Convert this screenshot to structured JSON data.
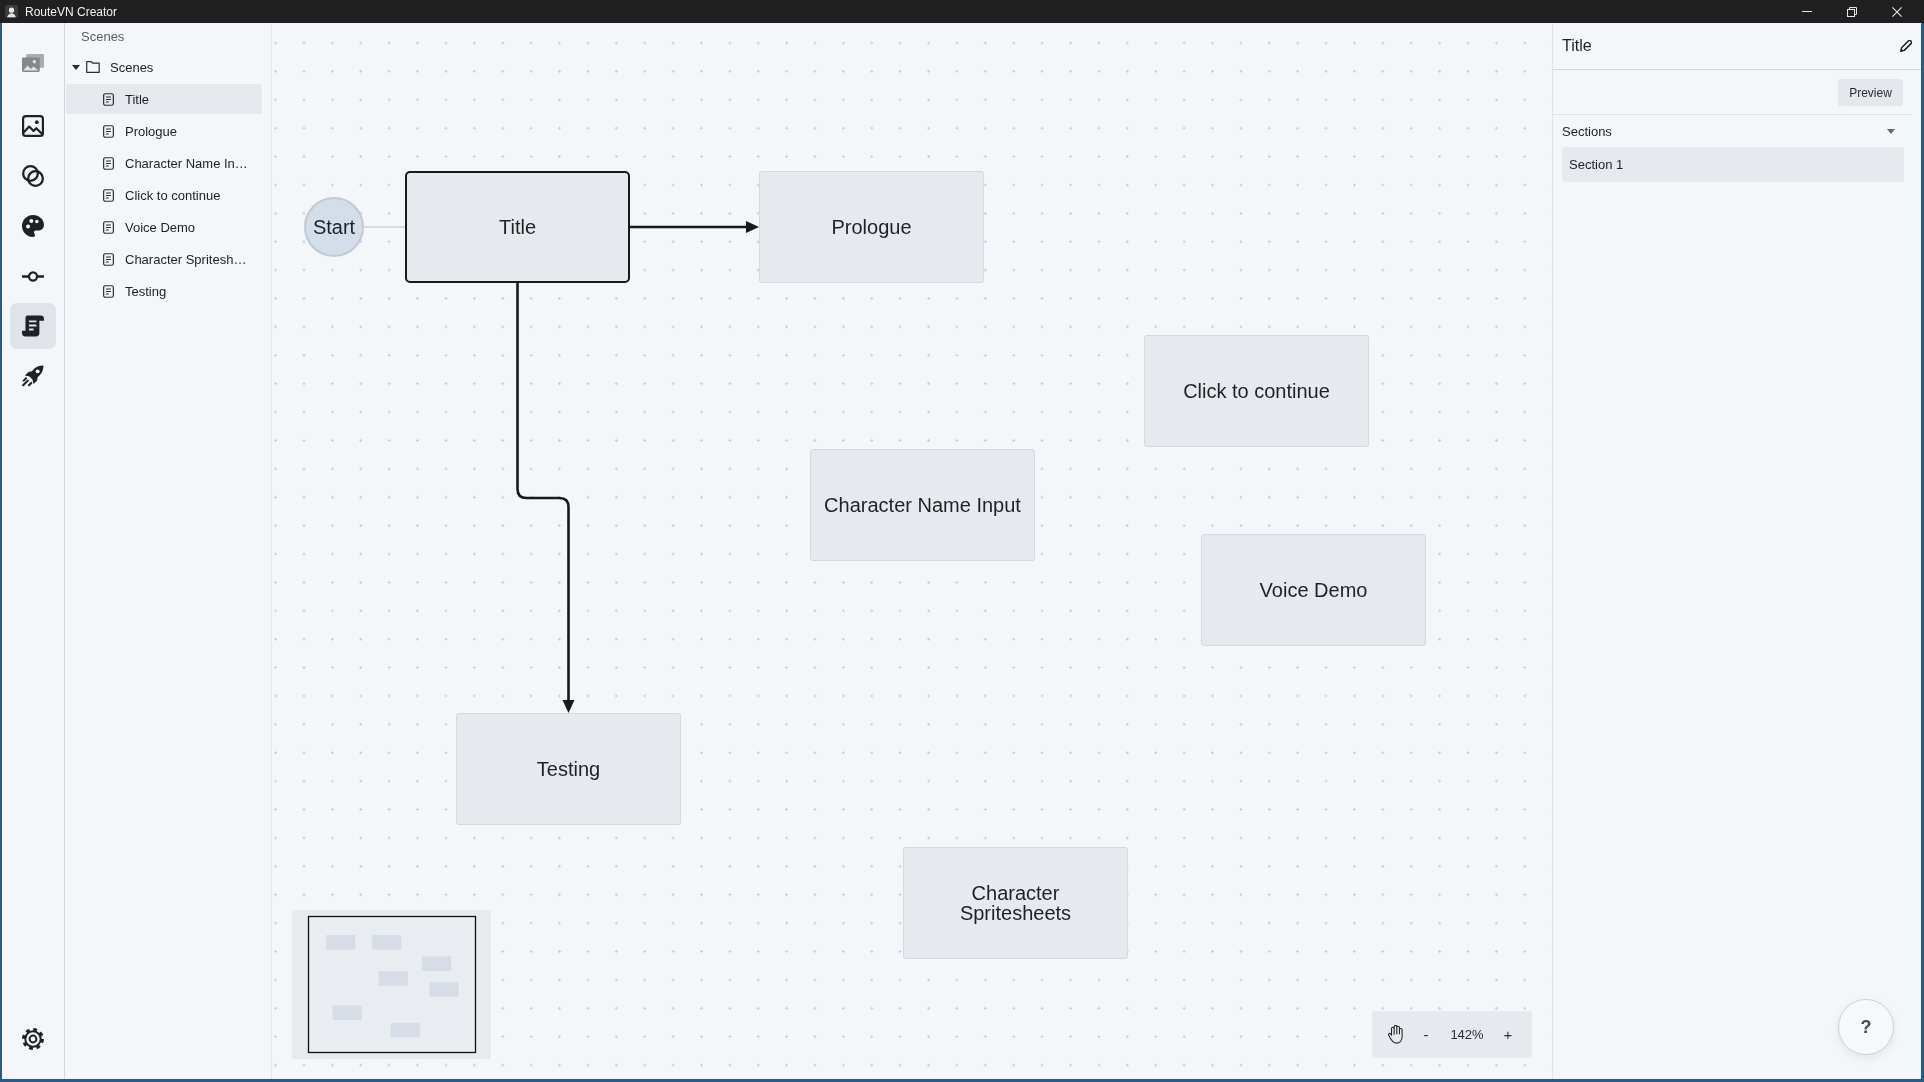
{
  "window": {
    "title": "RouteVN Creator"
  },
  "nav_rail": [
    {
      "selected": false
    },
    {
      "selected": false
    },
    {
      "selected": false
    },
    {
      "selected": false
    },
    {
      "selected": false
    },
    {
      "selected": true
    },
    {
      "selected": false
    }
  ],
  "sidebar": {
    "title": "Scenes",
    "tree": [
      {
        "label": "Scenes",
        "expanded": true,
        "children": [
          {
            "label": "Title",
            "selected": true
          },
          {
            "label": "Prologue",
            "selected": false
          },
          {
            "label": "Character Name In…",
            "selected": false
          },
          {
            "label": "Click to continue",
            "selected": false
          },
          {
            "label": "Voice Demo",
            "selected": false
          },
          {
            "label": "Character Spritesh…",
            "selected": false
          },
          {
            "label": "Testing",
            "selected": false
          }
        ]
      }
    ]
  },
  "canvas": {
    "nodes": [
      {
        "kind": "start",
        "label": "Start",
        "selected": false,
        "next": [
          {
            "kind": "scene",
            "label": "Title",
            "selected": true,
            "next": [
              {
                "kind": "scene",
                "label": "Prologue",
                "selected": false
              },
              {
                "kind": "scene",
                "label": "Testing",
                "selected": false
              }
            ]
          }
        ]
      },
      {
        "kind": "scene",
        "label": "Click to continue",
        "selected": false
      },
      {
        "kind": "scene",
        "label": "Character Name Input",
        "selected": false
      },
      {
        "kind": "scene",
        "label": "Voice Demo",
        "selected": false
      },
      {
        "kind": "scene",
        "label": "Character Spritesheets",
        "selected": false
      }
    ],
    "zoom": {
      "zoom_out": "-",
      "reading": "142%",
      "zoom_in": "+"
    }
  },
  "inspector": {
    "title": "Title",
    "preview_button": "Preview",
    "sections": {
      "label": "Sections",
      "expanded": true,
      "items": [
        {
          "label": "Section 1"
        }
      ]
    }
  },
  "help_button": "?"
}
